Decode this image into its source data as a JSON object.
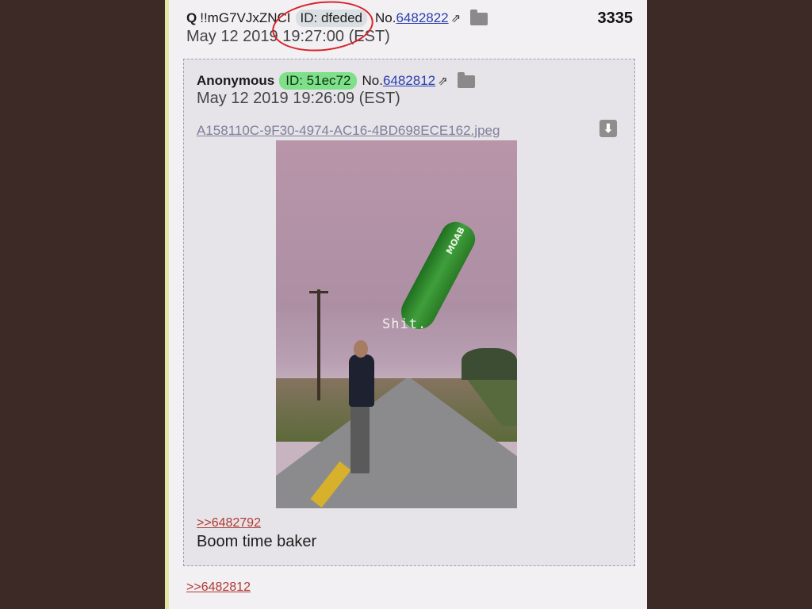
{
  "post": {
    "name": "Q",
    "tripcode": "!!mG7VJxZNCI",
    "id_label": "ID: dfeded",
    "no_prefix": "No.",
    "no_value": "6482822",
    "reply_count": "3335",
    "datetime": "May 12 2019 19:27:00 (EST)",
    "quote_link": ">>6482812"
  },
  "quoted": {
    "name": "Anonymous",
    "id_label": "ID: 51ec72",
    "no_prefix": "No.",
    "no_value": "6482812",
    "datetime": "May 12 2019 19:26:09 (EST)",
    "filename": "A158110C-9F30-4974-AC16-4BD698ECE162.jpeg",
    "image_caption": "Shit.",
    "bomb_text": "MOAB",
    "reply_link": ">>6482792",
    "body": "Boom time baker"
  },
  "icons": {
    "external_link": "external-link-icon",
    "folder": "folder-icon",
    "download": "download-icon"
  },
  "colors": {
    "background": "#3d2a27",
    "page": "#f2f0f3",
    "quote_box": "#e6e4e8",
    "id_green": "#7ee08a",
    "link_red": "#b03a34",
    "link_blue": "#2a3fb0",
    "annotation_red": "#d8242b"
  }
}
